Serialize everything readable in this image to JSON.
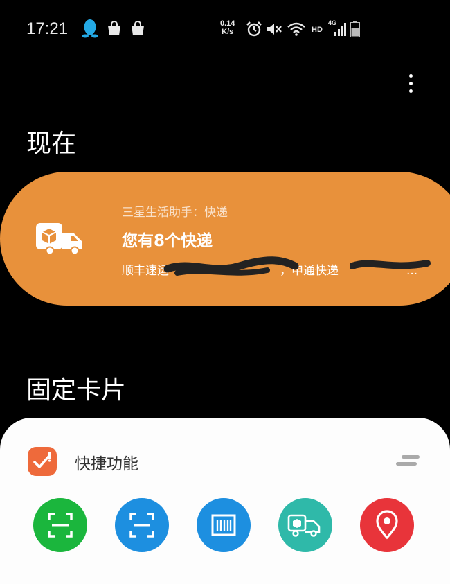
{
  "status_bar": {
    "time": "17:21",
    "net_speed_value": "0.14",
    "net_speed_unit": "K/s",
    "hd_label": "HD",
    "network_label": "4G",
    "icons": [
      "qq-penguin-icon",
      "shopping-bag-icon",
      "shopping-bag-icon",
      "alarm-icon",
      "mute-icon",
      "wifi-icon",
      "signal-icon",
      "battery-icon"
    ]
  },
  "menu": {
    "icon": "more-vertical-icon"
  },
  "now_section": {
    "title": "现在",
    "card": {
      "icon": "delivery-truck-icon",
      "background": "#E8913B",
      "source": "三星生活助手：快递",
      "title": "您有8个快递",
      "detail_prefix": "顺丰速运",
      "detail_middle": "，申通快递",
      "detail_suffix": "..."
    }
  },
  "pinned_section": {
    "title": "固定卡片",
    "quick_actions": {
      "title": "快捷功能",
      "icon": "checklist-icon",
      "icon_color": "#EE6A3B",
      "handle_icon": "drag-handle-icon",
      "actions": [
        {
          "icon": "scan-icon",
          "color": "#1BB63D"
        },
        {
          "icon": "scan-icon",
          "color": "#1D8FE0"
        },
        {
          "icon": "barcode-icon",
          "color": "#1D8FE0"
        },
        {
          "icon": "delivery-truck-icon",
          "color": "#2FB9A9"
        },
        {
          "icon": "location-pin-icon",
          "color": "#E8343A"
        }
      ]
    }
  }
}
